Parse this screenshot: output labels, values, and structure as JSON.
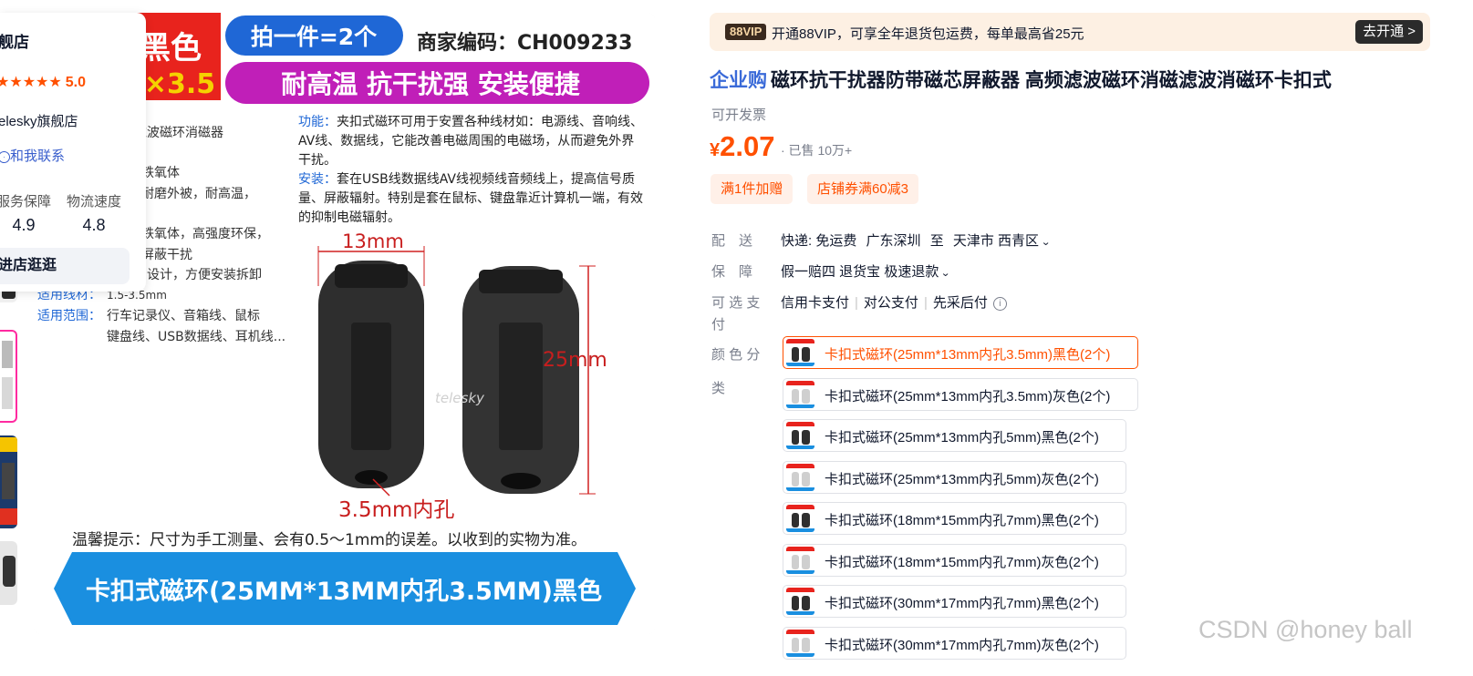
{
  "image": {
    "color_tag": "黑色",
    "size_tag": "×3.5",
    "per_order": "拍一件=2个",
    "merchant_code": "商家编码：CH009233",
    "features": "耐高温 抗干扰强 安装便捷",
    "left_lines": [
      "滤波磁环消磁器",
      "铁氧体",
      "耐磨外被，耐高温，",
      "铁氧体，高强度环保，",
      "屏蔽干扰",
      "扣设计，方便安装拆卸"
    ],
    "wire_label": "适用线材：",
    "wire_value": "1.5-3.5mm",
    "scope_label": "适用范围：",
    "scope_value1": "行车记录仪、音箱线、鼠标",
    "scope_value2": "键盘线、USB数据线、耳机线...",
    "func_label": "功能：",
    "func_text": "夹扣式磁环可用于安置各种线材如：电源线、音响线、AV线、数据线，它能改善电磁周围的电磁场，从而避免外界干扰。",
    "install_label": "安装：",
    "install_text": "套在USB线数据线AV线视频线音频线上，提高信号质量、屏蔽辐射。特别是套在鼠标、键盘靠近计算机一端，有效的抑制电磁辐射。",
    "dim_width": "13mm",
    "dim_height": "25mm",
    "dim_hole": "3.5mm内孔",
    "tip": "温馨提示：尺寸为手工测量、会有0.5～1mm的误差。以收到的实物为准。",
    "banner": "卡扣式磁环(25MM*13MM内孔3.5MM)黑色",
    "brand_mark": "telesky"
  },
  "shop": {
    "name": "舰店",
    "stars": "★★★★★",
    "score": "5.0",
    "sub": "elesky旗舰店",
    "contact": "和我联系",
    "service_label": "服务保障",
    "service_value": "4.9",
    "logistics_label": "物流速度",
    "logistics_value": "4.8",
    "enter": "进店逛逛"
  },
  "vip": {
    "badge": "88VIP",
    "text": "开通88VIP，可享全年退货包运费，每单最高省25元",
    "button": "去开通 >"
  },
  "product": {
    "corp_tag": "企业购",
    "title": "磁环抗干扰器防带磁芯屏蔽器 高频滤波磁环消磁滤波消磁环卡扣式",
    "invoice": "可开发票",
    "currency": "¥",
    "price": "2.07",
    "sold": "· 已售 10万+",
    "coupons": [
      "满1件加赠",
      "店铺券满60减3"
    ]
  },
  "delivery": {
    "label": "配　送",
    "method": "快递: 免运费",
    "from": "广东深圳",
    "to_word": "至",
    "to": "天津市 西青区"
  },
  "guarantee": {
    "label": "保　障",
    "value": "假一赔四 退货宝 极速退款"
  },
  "payment": {
    "label1": "可 选 支",
    "label2": "付",
    "options": [
      "信用卡支付",
      "对公支付",
      "先采后付"
    ]
  },
  "sku": {
    "label1": "颜 色 分",
    "label2": "类",
    "selected_index": 0,
    "options": [
      "卡扣式磁环(25mm*13mm内孔3.5mm)黑色(2个)",
      "卡扣式磁环(25mm*13mm内孔3.5mm)灰色(2个)",
      "卡扣式磁环(25mm*13mm内孔5mm)黑色(2个)",
      "卡扣式磁环(25mm*13mm内孔5mm)灰色(2个)",
      "卡扣式磁环(18mm*15mm内孔7mm)黑色(2个)",
      "卡扣式磁环(18mm*15mm内孔7mm)灰色(2个)",
      "卡扣式磁环(30mm*17mm内孔7mm)黑色(2个)",
      "卡扣式磁环(30mm*17mm内孔7mm)灰色(2个)"
    ]
  },
  "watermark": "CSDN @honey ball",
  "colors": {
    "accent": "#ff5000",
    "corp_blue": "#3a6ad8",
    "vip_bg": "#fdf0e3",
    "banner_blue": "#1a8fe0",
    "magenta": "#c01fb8"
  }
}
